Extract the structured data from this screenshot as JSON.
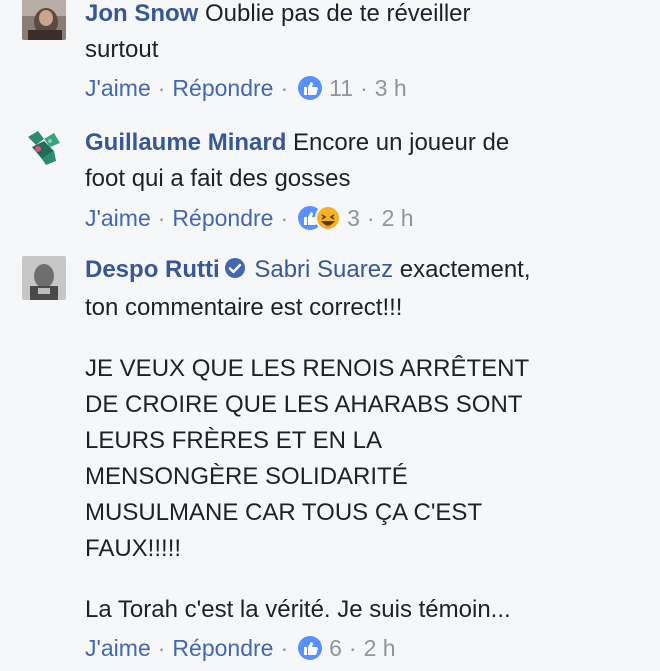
{
  "comments": [
    {
      "author": "Jon Snow",
      "text_lines": [
        "Oublie pas de te réveiller",
        "surtout"
      ],
      "like_label": "J'aime",
      "reply_label": "Répondre",
      "reactions": [
        "like"
      ],
      "reaction_count": "11",
      "time": "3 h"
    },
    {
      "author": "Guillaume Minard",
      "text_lines": [
        "Encore un joueur de",
        "foot qui a fait des gosses"
      ],
      "like_label": "J'aime",
      "reply_label": "Répondre",
      "reactions": [
        "like",
        "haha"
      ],
      "reaction_count": "3",
      "time": "2 h"
    },
    {
      "author": "Despo Rutti",
      "verified": true,
      "mention": "Sabri Suarez",
      "paragraphs": [
        [
          "exactement,",
          "ton commentaire est correct!!!"
        ],
        [
          "JE VEUX QUE LES RENOIS ARRÊTENT",
          "DE CROIRE QUE LES AHARABS SONT",
          "LEURS FRÈRES ET EN LA",
          "MENSONGÈRE SOLIDARITÉ",
          "MUSULMANE CAR TOUS ÇA C'EST",
          "FAUX!!!!!"
        ],
        [
          "La Torah c'est la vérité. Je suis témoin..."
        ]
      ],
      "like_label": "J'aime",
      "reply_label": "Répondre",
      "reactions": [
        "like"
      ],
      "reaction_count": "6",
      "time": "2 h"
    }
  ],
  "colors": {
    "link": "#365899",
    "action": "#4267b2",
    "meta": "#90949c",
    "like_reaction": "#5890ff",
    "haha_reaction": "#f7b125"
  },
  "icons": [
    "avatar-jon-snow",
    "avatar-guillaume-minard",
    "avatar-despo-rutti",
    "like-reaction-icon",
    "haha-reaction-icon",
    "verified-badge-icon"
  ]
}
